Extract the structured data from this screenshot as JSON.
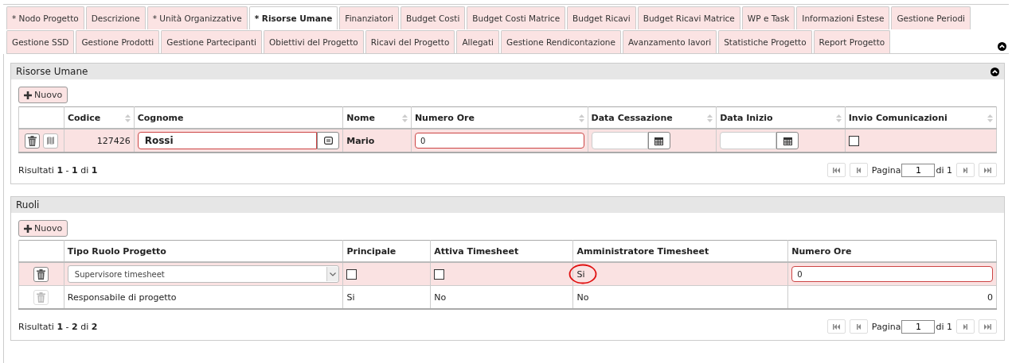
{
  "tab_rows": [
    [
      {
        "label": "* Nodo Progetto",
        "selected": false
      },
      {
        "label": "Descrizione",
        "selected": false
      },
      {
        "label": "* Unità Organizzative",
        "selected": false
      },
      {
        "label": "* Risorse Umane",
        "selected": true
      },
      {
        "label": "Finanziatori",
        "selected": false
      },
      {
        "label": "Budget Costi",
        "selected": false
      },
      {
        "label": "Budget Costi Matrice",
        "selected": false
      },
      {
        "label": "Budget Ricavi",
        "selected": false
      },
      {
        "label": "Budget Ricavi Matrice",
        "selected": false
      },
      {
        "label": "WP e Task",
        "selected": false
      },
      {
        "label": "Informazioni Estese",
        "selected": false
      },
      {
        "label": "Gestione Periodi",
        "selected": false
      }
    ],
    [
      {
        "label": "Gestione SSD",
        "selected": false
      },
      {
        "label": "Gestione Prodotti",
        "selected": false
      },
      {
        "label": "Gestione Partecipanti",
        "selected": false
      },
      {
        "label": "Obiettivi del Progetto",
        "selected": false
      },
      {
        "label": "Ricavi del Progetto",
        "selected": false
      },
      {
        "label": "Allegati",
        "selected": false
      },
      {
        "label": "Gestione Rendicontazione",
        "selected": false
      },
      {
        "label": "Avanzamento lavori",
        "selected": false
      },
      {
        "label": "Statistiche Progetto",
        "selected": false
      },
      {
        "label": "Report Progetto",
        "selected": false
      }
    ]
  ],
  "panels": [
    {
      "title": "Risorse Umane",
      "collapsible": true,
      "new_button": "Nuovo",
      "columns": [
        {
          "label": "Codice",
          "sortable": true
        },
        {
          "label": "Cognome",
          "sortable": false
        },
        {
          "label": "Nome",
          "sortable": true
        },
        {
          "label": "Numero Ore",
          "sortable": true
        },
        {
          "label": "Data Cessazione",
          "sortable": true
        },
        {
          "label": "Data Inizio",
          "sortable": true
        },
        {
          "label": "Invio Comunicazioni",
          "sortable": true
        }
      ],
      "rows": [
        {
          "editing": true,
          "actions": [
            {
              "kind": "delete",
              "disabled": false
            },
            {
              "kind": "detail",
              "disabled": false
            }
          ],
          "cells": [
            {
              "kind": "text",
              "value": "127426",
              "right_aligned": true,
              "bold": false
            },
            {
              "kind": "lookup",
              "value": "Rossi"
            },
            {
              "kind": "text",
              "value": "Mario",
              "right_aligned": false,
              "bold": true
            },
            {
              "kind": "field",
              "value": "0"
            },
            {
              "kind": "date"
            },
            {
              "kind": "date"
            },
            {
              "kind": "checkbox",
              "checked": false
            }
          ]
        }
      ],
      "results": "Risultati **1** - **1** di **1**",
      "page_label": "Pagina",
      "page": "1",
      "page_total": "di 1"
    },
    {
      "title": "Ruoli",
      "collapsible": false,
      "new_button": "Nuovo",
      "columns": [
        {
          "label": "Tipo Ruolo Progetto",
          "sortable": false
        },
        {
          "label": "Principale",
          "sortable": false
        },
        {
          "label": "Attiva Timesheet",
          "sortable": false
        },
        {
          "label": "Amministratore Timesheet",
          "sortable": false
        },
        {
          "label": "Numero Ore",
          "sortable": false
        }
      ],
      "rows": [
        {
          "editing": true,
          "actions": [
            {
              "kind": "delete",
              "disabled": false
            }
          ],
          "cells": [
            {
              "kind": "select",
              "value": "Supervisore timesheet"
            },
            {
              "kind": "checkbox",
              "checked": false
            },
            {
              "kind": "checkbox",
              "checked": false
            },
            {
              "kind": "text",
              "value": "Si",
              "right_aligned": false,
              "bold": false,
              "circled": true
            },
            {
              "kind": "field",
              "value": "0"
            }
          ]
        },
        {
          "editing": false,
          "actions": [
            {
              "kind": "delete",
              "disabled": true
            }
          ],
          "cells": [
            {
              "kind": "text",
              "value": "Responsabile di progetto",
              "right_aligned": false,
              "bold": false
            },
            {
              "kind": "text",
              "value": "Si",
              "right_aligned": false,
              "bold": false
            },
            {
              "kind": "text",
              "value": "No",
              "right_aligned": false,
              "bold": false
            },
            {
              "kind": "text",
              "value": "No",
              "right_aligned": false,
              "bold": false
            },
            {
              "kind": "text",
              "value": "0",
              "right_aligned": true,
              "bold": false
            }
          ]
        }
      ],
      "results": "Risultati **1** - **2** di **2**",
      "page_label": "Pagina",
      "page": "1",
      "page_total": "di 1"
    }
  ]
}
